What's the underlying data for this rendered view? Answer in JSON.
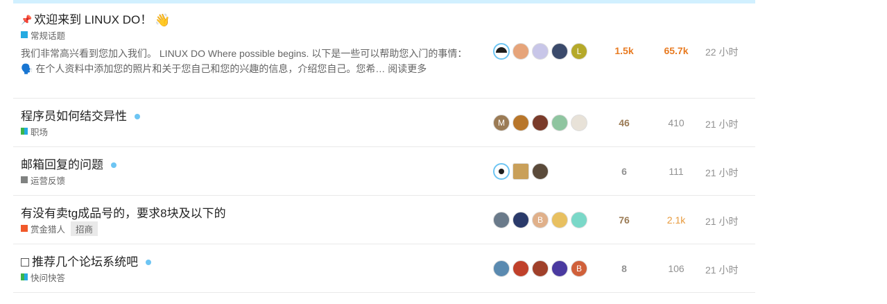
{
  "topics": [
    {
      "title": "欢迎来到 LINUX DO！",
      "emoji": "👋",
      "pinned_icon": "pin-icon",
      "category": "常规话题",
      "category_color": "#25aae1",
      "excerpt": "我们非常高兴看到您加入我们。 LINUX DO Where possible begins. 以下是一些可以帮助您入门的事情： 🗣️ 在个人资料中添加您的照片和关于您自己和您的兴趣的信息，介绍您自己。您希…",
      "read_more": "阅读更多",
      "posters": [
        {
          "name": "avatar-1",
          "color": "#1e1e1e",
          "letter": ""
        },
        {
          "name": "avatar-2",
          "color": "#e6a47a",
          "letter": ""
        },
        {
          "name": "avatar-3",
          "color": "#c8c6e8",
          "letter": ""
        },
        {
          "name": "avatar-4",
          "color": "#3b4a6b",
          "letter": ""
        },
        {
          "name": "avatar-5",
          "color": "#b5a92a",
          "letter": "L"
        }
      ],
      "replies": "1.5k",
      "views": "65.7k",
      "activity": "22 小时"
    },
    {
      "title": "程序员如何结交异性",
      "category": "职场",
      "category_color": "#3ab54a",
      "posters": [
        {
          "name": "avatar-1",
          "color": "#9b7b55",
          "letter": "M"
        },
        {
          "name": "avatar-2",
          "color": "#b8762a",
          "letter": ""
        },
        {
          "name": "avatar-3",
          "color": "#7a3b2a",
          "letter": ""
        },
        {
          "name": "avatar-4",
          "color": "#8fc5a0",
          "letter": ""
        },
        {
          "name": "avatar-5",
          "color": "#e8e2d8",
          "letter": ""
        }
      ],
      "replies": "46",
      "views": "410",
      "activity": "21 小时"
    },
    {
      "title": "邮箱回复的问题",
      "category": "运营反馈",
      "category_color": "#808281",
      "posters": [
        {
          "name": "avatar-1",
          "color": "#ffffff",
          "letter": ""
        },
        {
          "name": "avatar-2",
          "color": "#c9a05a",
          "letter": ""
        },
        {
          "name": "avatar-3",
          "color": "#5a4a3a",
          "letter": ""
        }
      ],
      "replies": "6",
      "views": "111",
      "activity": "21 小时"
    },
    {
      "title": "有没有卖tg成品号的，要求8块及以下的",
      "category": "赏金猎人",
      "category_color": "#f1592a",
      "tag": "招商",
      "posters": [
        {
          "name": "avatar-1",
          "color": "#6a7a8a",
          "letter": ""
        },
        {
          "name": "avatar-2",
          "color": "#2a3a6a",
          "letter": ""
        },
        {
          "name": "avatar-3",
          "color": "#e0b08a",
          "letter": "B"
        },
        {
          "name": "avatar-4",
          "color": "#e8c060",
          "letter": ""
        },
        {
          "name": "avatar-5",
          "color": "#7ad8c8",
          "letter": ""
        }
      ],
      "replies": "76",
      "views": "2.1k",
      "activity": "21 小时"
    },
    {
      "title": "推荐几个论坛系统吧",
      "category": "快问快答",
      "category_color": "#3ab54a",
      "posters": [
        {
          "name": "avatar-1",
          "color": "#5a8ab0",
          "letter": ""
        },
        {
          "name": "avatar-2",
          "color": "#c0402a",
          "letter": ""
        },
        {
          "name": "avatar-3",
          "color": "#a0402a",
          "letter": ""
        },
        {
          "name": "avatar-4",
          "color": "#4a3aa0",
          "letter": ""
        },
        {
          "name": "avatar-5",
          "color": "#d0603a",
          "letter": "B"
        }
      ],
      "replies": "8",
      "views": "106",
      "activity": "21 小时"
    }
  ]
}
